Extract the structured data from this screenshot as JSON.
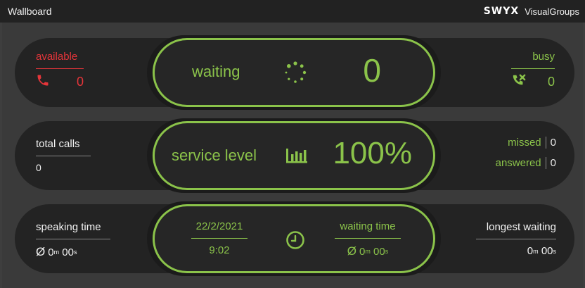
{
  "titlebar": {
    "title": "Wallboard",
    "brand_logo": "SWYX",
    "brand_name": "VisualGroups"
  },
  "colors": {
    "accent_green": "#8bc34a",
    "alert_red": "#e5353a",
    "panel": "#232323",
    "background": "#3e3e3e"
  },
  "row_status": {
    "available": {
      "label": "available",
      "value": "0",
      "icon": "phone-icon"
    },
    "waiting": {
      "label": "waiting",
      "value": "0",
      "icon": "spinner-icon"
    },
    "busy": {
      "label": "busy",
      "value": "0",
      "icon": "busy-phone-icon"
    }
  },
  "row_service": {
    "total_calls": {
      "label": "total calls",
      "value": "0"
    },
    "service_level": {
      "label": "service level",
      "value": "100%",
      "icon": "bar-chart-icon"
    },
    "missed": {
      "label": "missed",
      "value": "0"
    },
    "answered": {
      "label": "answered",
      "value": "0"
    }
  },
  "row_time": {
    "speaking_time": {
      "label": "speaking time",
      "avg_symbol": "Ø",
      "minutes": "0",
      "min_unit": "m",
      "seconds": "00",
      "sec_unit": "s"
    },
    "date": "22/2/2021",
    "time": "9:02",
    "clock_icon": "clock-icon",
    "waiting_time": {
      "label": "waiting time",
      "avg_symbol": "Ø",
      "minutes": "0",
      "min_unit": "m",
      "seconds": "00",
      "sec_unit": "s"
    },
    "longest_waiting": {
      "label": "longest waiting",
      "minutes": "0",
      "min_unit": "m",
      "seconds": "00",
      "sec_unit": "s"
    }
  }
}
